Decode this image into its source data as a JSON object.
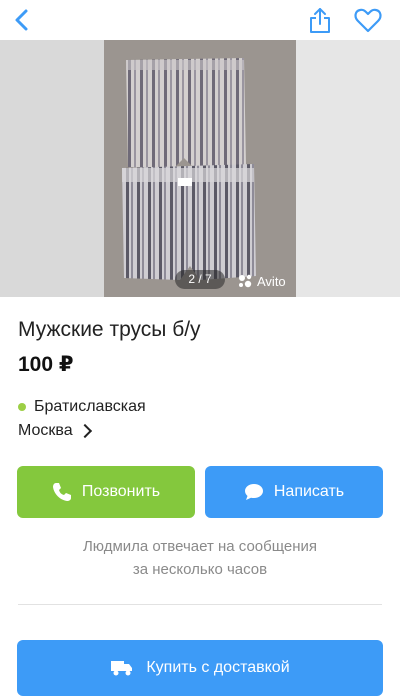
{
  "header": {
    "back_icon": "back-chevron-icon",
    "share_icon": "share-icon",
    "favorite_icon": "heart-icon",
    "accent": "#3d9bf7"
  },
  "gallery": {
    "counter": "2 / 7",
    "watermark": "Avito"
  },
  "listing": {
    "title": "Мужские трусы б/у",
    "price": "100 ₽",
    "metro_station": "Братиславская",
    "metro_color": "#9ccf45",
    "city": "Москва"
  },
  "actions": {
    "call_label": "Позвонить",
    "call_color": "#84c83d",
    "write_label": "Написать",
    "write_color": "#3d9bf7"
  },
  "seller_reply": {
    "line1": "Людмила отвечает на сообщения",
    "line2": "за несколько часов"
  },
  "delivery": {
    "buy_label": "Купить с доставкой"
  }
}
